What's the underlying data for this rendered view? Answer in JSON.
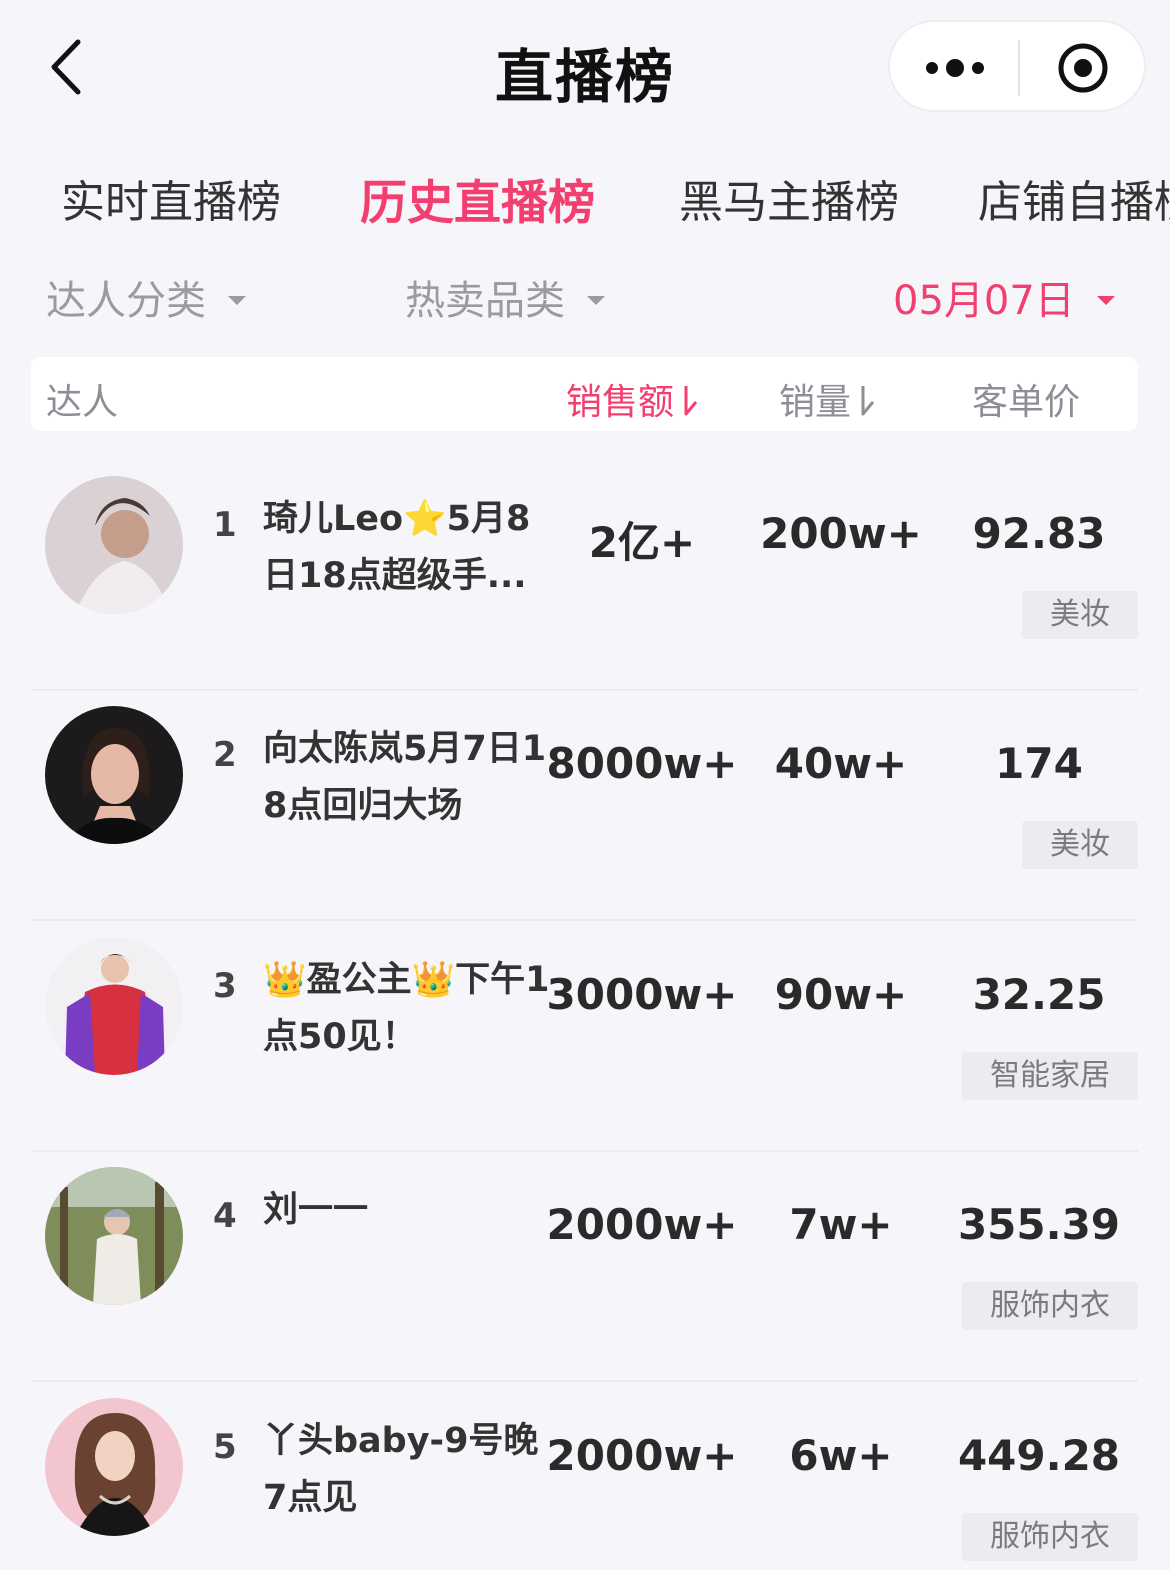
{
  "nav": {
    "title": "直播榜"
  },
  "tabs": [
    {
      "label": "实时直播榜",
      "active": false
    },
    {
      "label": "历史直播榜",
      "active": true
    },
    {
      "label": "黑马主播榜",
      "active": false
    },
    {
      "label": "店铺自播榜",
      "active": false
    }
  ],
  "filters": {
    "category": "达人分类",
    "hot_category": "热卖品类",
    "date": "05月07日"
  },
  "table": {
    "headers": {
      "talent": "达人",
      "sales": "销售额",
      "volume": "销量",
      "unit_price": "客单价"
    },
    "active_sort": "sales",
    "rows": [
      {
        "rank": "1",
        "name": "琦儿Leo⭐5月8日18点超级手...",
        "sales": "2亿+",
        "volume": "200w+",
        "unit_price": "92.83",
        "tag": "美妆"
      },
      {
        "rank": "2",
        "name": "向太陈岚5月7日18点回归大场",
        "sales": "8000w+",
        "volume": "40w+",
        "unit_price": "174",
        "tag": "美妆"
      },
      {
        "rank": "3",
        "name": "👑盈公主👑下午1点50见！",
        "sales": "3000w+",
        "volume": "90w+",
        "unit_price": "32.25",
        "tag": "智能家居"
      },
      {
        "rank": "4",
        "name": "刘一一",
        "sales": "2000w+",
        "volume": "7w+",
        "unit_price": "355.39",
        "tag": "服饰内衣"
      },
      {
        "rank": "5",
        "name": "丫头baby-9号晚7点见",
        "sales": "2000w+",
        "volume": "6w+",
        "unit_price": "449.28",
        "tag": "服饰内衣"
      }
    ]
  },
  "colors": {
    "accent": "#f23f6f",
    "background": "#f6f6fa",
    "muted": "#9a9aa2"
  }
}
